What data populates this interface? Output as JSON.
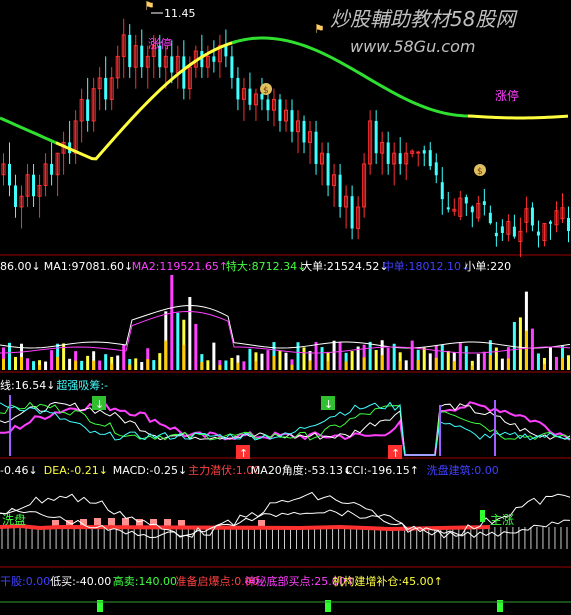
{
  "watermark": {
    "cn": "炒股輔助教材58股网",
    "url": "www.58Gu.com"
  },
  "price_panel": {
    "high_label": "11.45",
    "zhangting_label": "涨停",
    "money_badge": "$",
    "ma_line_colors": {
      "up": "#ffff40",
      "down": "#30e030"
    }
  },
  "volume_panel": {
    "indicators": [
      {
        "text": "86.00",
        "arrow": "↓",
        "color": "#ffffff"
      },
      {
        "text": "MA1:97081.60",
        "arrow": "↓",
        "color": "#ffffff"
      },
      {
        "text": "MA2:119521.65",
        "arrow": "↑",
        "color": "#ff40ff"
      },
      {
        "text": "特大:8712.34",
        "arrow": "↓",
        "color": "#40ff40"
      },
      {
        "text": "大单:21524.52",
        "arrow": "↓",
        "color": "#ffffff"
      },
      {
        "text": "中单:18012.10",
        "arrow": "↓",
        "color": "#4040ff"
      },
      {
        "text": "小单:220",
        "arrow": "",
        "color": "#ffffff"
      }
    ]
  },
  "mid_panel": {
    "indicators": [
      {
        "text": "线:16.54",
        "arrow": "↓",
        "color": "#ffffff"
      },
      {
        "text": "超强吸筹:-",
        "arrow": "",
        "color": "#40ffff"
      }
    ]
  },
  "lower_panel": {
    "indicators": [
      {
        "text": "-0.46",
        "arrow": "↓",
        "color": "#ffffff"
      },
      {
        "text": "DEA:-0.21",
        "arrow": "↓",
        "color": "#ffff40"
      },
      {
        "text": "MACD:-0.25",
        "arrow": "↓",
        "color": "#ffffff"
      },
      {
        "text": "主力潜伏:1.00",
        "arrow": "",
        "color": "#ff4040"
      },
      {
        "text": "MA20角度:-53.13",
        "arrow": "↓",
        "color": "#ffffff"
      },
      {
        "text": "CCI:-196.15",
        "arrow": "↑",
        "color": "#ffffff"
      },
      {
        "text": "洗盘建筑:0.00",
        "arrow": "",
        "color": "#4040ff"
      }
    ],
    "xipan_label": "洗盘",
    "zhuzhang_label": "主涨"
  },
  "bottom_panel": {
    "indicators": [
      {
        "text": "干股:0.00",
        "arrow": "",
        "color": "#4040ff"
      },
      {
        "text": "低买:-40.00",
        "arrow": "",
        "color": "#ffffff"
      },
      {
        "text": "高卖:140.00",
        "arrow": "",
        "color": "#40ff40"
      },
      {
        "text": "准备启爆点:0.00",
        "arrow": "",
        "color": "#ff4040"
      },
      {
        "text": "神秘底部买点:25.00",
        "arrow": "↑",
        "color": "#ff40ff"
      },
      {
        "text": "机构建增补仓:45.00",
        "arrow": "↑",
        "color": "#ffff40"
      }
    ]
  },
  "chart_data": {
    "type": "candlestick",
    "title": "",
    "high_marker": 11.45,
    "candles_count": 95,
    "candles": [
      [
        0,
        10.0,
        10.2,
        9.9,
        10.1
      ],
      [
        1,
        10.1,
        10.3,
        9.8,
        9.9
      ],
      [
        2,
        9.9,
        10.0,
        9.6,
        9.7
      ],
      [
        3,
        9.7,
        9.9,
        9.5,
        9.8
      ],
      [
        4,
        9.8,
        10.1,
        9.7,
        10.0
      ],
      [
        5,
        10.0,
        10.1,
        9.7,
        9.8
      ],
      [
        6,
        9.8,
        10.0,
        9.6,
        9.9
      ],
      [
        7,
        9.9,
        10.2,
        9.8,
        10.1
      ],
      [
        8,
        10.1,
        10.3,
        9.9,
        10.0
      ],
      [
        9,
        10.0,
        10.2,
        9.8,
        10.2
      ],
      [
        10,
        10.2,
        10.4,
        10.0,
        10.3
      ],
      [
        11,
        10.3,
        10.5,
        10.1,
        10.2
      ],
      [
        12,
        10.2,
        10.6,
        10.1,
        10.5
      ],
      [
        13,
        10.5,
        10.8,
        10.3,
        10.7
      ],
      [
        14,
        10.7,
        10.9,
        10.4,
        10.5
      ],
      [
        15,
        10.5,
        10.9,
        10.4,
        10.8
      ],
      [
        16,
        10.8,
        11.0,
        10.6,
        10.9
      ],
      [
        17,
        10.9,
        11.1,
        10.6,
        10.7
      ],
      [
        18,
        10.7,
        11.0,
        10.6,
        10.9
      ],
      [
        19,
        10.9,
        11.2,
        10.8,
        11.1
      ],
      [
        20,
        11.1,
        11.45,
        10.9,
        11.3
      ],
      [
        21,
        11.3,
        11.4,
        10.9,
        11.0
      ],
      [
        22,
        11.0,
        11.3,
        10.8,
        11.2
      ],
      [
        23,
        11.2,
        11.35,
        10.9,
        11.0
      ],
      [
        24,
        11.0,
        11.2,
        10.8,
        11.1
      ],
      [
        25,
        11.1,
        11.3,
        10.9,
        11.2
      ],
      [
        26,
        11.2,
        11.3,
        10.9,
        11.0
      ],
      [
        27,
        11.0,
        11.2,
        10.8,
        11.1
      ],
      [
        28,
        11.1,
        11.25,
        10.85,
        10.95
      ],
      [
        29,
        10.95,
        11.2,
        10.8,
        11.1
      ],
      [
        30,
        11.1,
        11.25,
        10.7,
        10.8
      ],
      [
        31,
        10.8,
        11.1,
        10.7,
        11.0
      ],
      [
        32,
        11.0,
        11.2,
        10.9,
        11.15
      ],
      [
        33,
        11.15,
        11.3,
        10.9,
        11.0
      ],
      [
        34,
        11.0,
        11.2,
        10.9,
        11.1
      ],
      [
        35,
        11.1,
        11.25,
        10.95,
        11.05
      ],
      [
        36,
        11.05,
        11.3,
        10.9,
        11.2
      ],
      [
        37,
        11.2,
        11.35,
        11.0,
        11.1
      ],
      [
        38,
        11.1,
        11.2,
        10.8,
        10.9
      ],
      [
        39,
        10.9,
        11.0,
        10.6,
        10.7
      ],
      [
        40,
        10.7,
        10.9,
        10.5,
        10.8
      ],
      [
        41,
        10.8,
        10.95,
        10.6,
        10.65
      ],
      [
        42,
        10.65,
        10.8,
        10.5,
        10.75
      ],
      [
        43,
        10.75,
        10.9,
        10.6,
        10.7
      ],
      [
        44,
        10.7,
        10.85,
        10.5,
        10.6
      ],
      [
        45,
        10.6,
        10.8,
        10.45,
        10.7
      ],
      [
        46,
        10.7,
        10.75,
        10.4,
        10.5
      ],
      [
        47,
        10.5,
        10.7,
        10.4,
        10.6
      ],
      [
        48,
        10.6,
        10.7,
        10.3,
        10.4
      ],
      [
        49,
        10.4,
        10.6,
        10.2,
        10.5
      ],
      [
        50,
        10.5,
        10.55,
        10.2,
        10.3
      ],
      [
        51,
        10.3,
        10.5,
        10.1,
        10.4
      ],
      [
        52,
        10.4,
        10.5,
        10.0,
        10.1
      ],
      [
        53,
        10.1,
        10.3,
        9.9,
        10.2
      ],
      [
        54,
        10.2,
        10.3,
        9.8,
        9.9
      ],
      [
        55,
        9.9,
        10.1,
        9.7,
        10.0
      ],
      [
        56,
        10.0,
        10.1,
        9.6,
        9.7
      ],
      [
        57,
        9.7,
        9.9,
        9.5,
        9.8
      ],
      [
        58,
        9.8,
        9.9,
        9.4,
        9.5
      ],
      [
        59,
        9.5,
        9.8,
        9.4,
        9.7
      ],
      [
        60,
        9.7,
        10.2,
        9.6,
        10.1
      ],
      [
        61,
        10.1,
        10.6,
        10.0,
        10.5
      ],
      [
        62,
        10.5,
        10.6,
        10.1,
        10.2
      ],
      [
        63,
        10.2,
        10.4,
        10.0,
        10.3
      ],
      [
        64,
        10.3,
        10.4,
        10.0,
        10.1
      ],
      [
        65,
        10.1,
        10.3,
        9.9,
        10.2
      ],
      [
        66,
        10.2,
        10.35,
        10.0,
        10.1
      ],
      [
        67,
        10.1,
        10.3,
        9.95,
        10.2
      ]
    ]
  }
}
